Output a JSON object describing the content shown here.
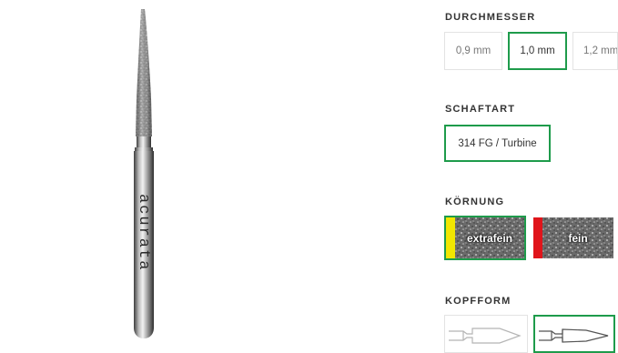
{
  "product": {
    "image_icon": "diamond-bur-flame-icon",
    "engraving": "acurata"
  },
  "durchmesser": {
    "title": "DURCHMESSER",
    "options": [
      {
        "label": "0,9 mm",
        "selected": false
      },
      {
        "label": "1,0 mm",
        "selected": true
      },
      {
        "label": "1,2 mm",
        "selected": false
      }
    ]
  },
  "schaftart": {
    "title": "SCHAFTART",
    "options": [
      {
        "label": "314 FG / Turbine",
        "selected": true
      }
    ]
  },
  "koernung": {
    "title": "KÖRNUNG",
    "options": [
      {
        "label": "extrafein",
        "color": "#f2e600",
        "selected": true
      },
      {
        "label": "fein",
        "color": "#e0151b",
        "selected": false
      }
    ]
  },
  "kopfform": {
    "title": "KOPFFORM",
    "options": [
      {
        "icon": "cylinder-pointed-shape-icon",
        "selected": false
      },
      {
        "icon": "flame-shape-icon",
        "selected": true
      }
    ]
  },
  "colors": {
    "accent": "#1e9b4b"
  }
}
